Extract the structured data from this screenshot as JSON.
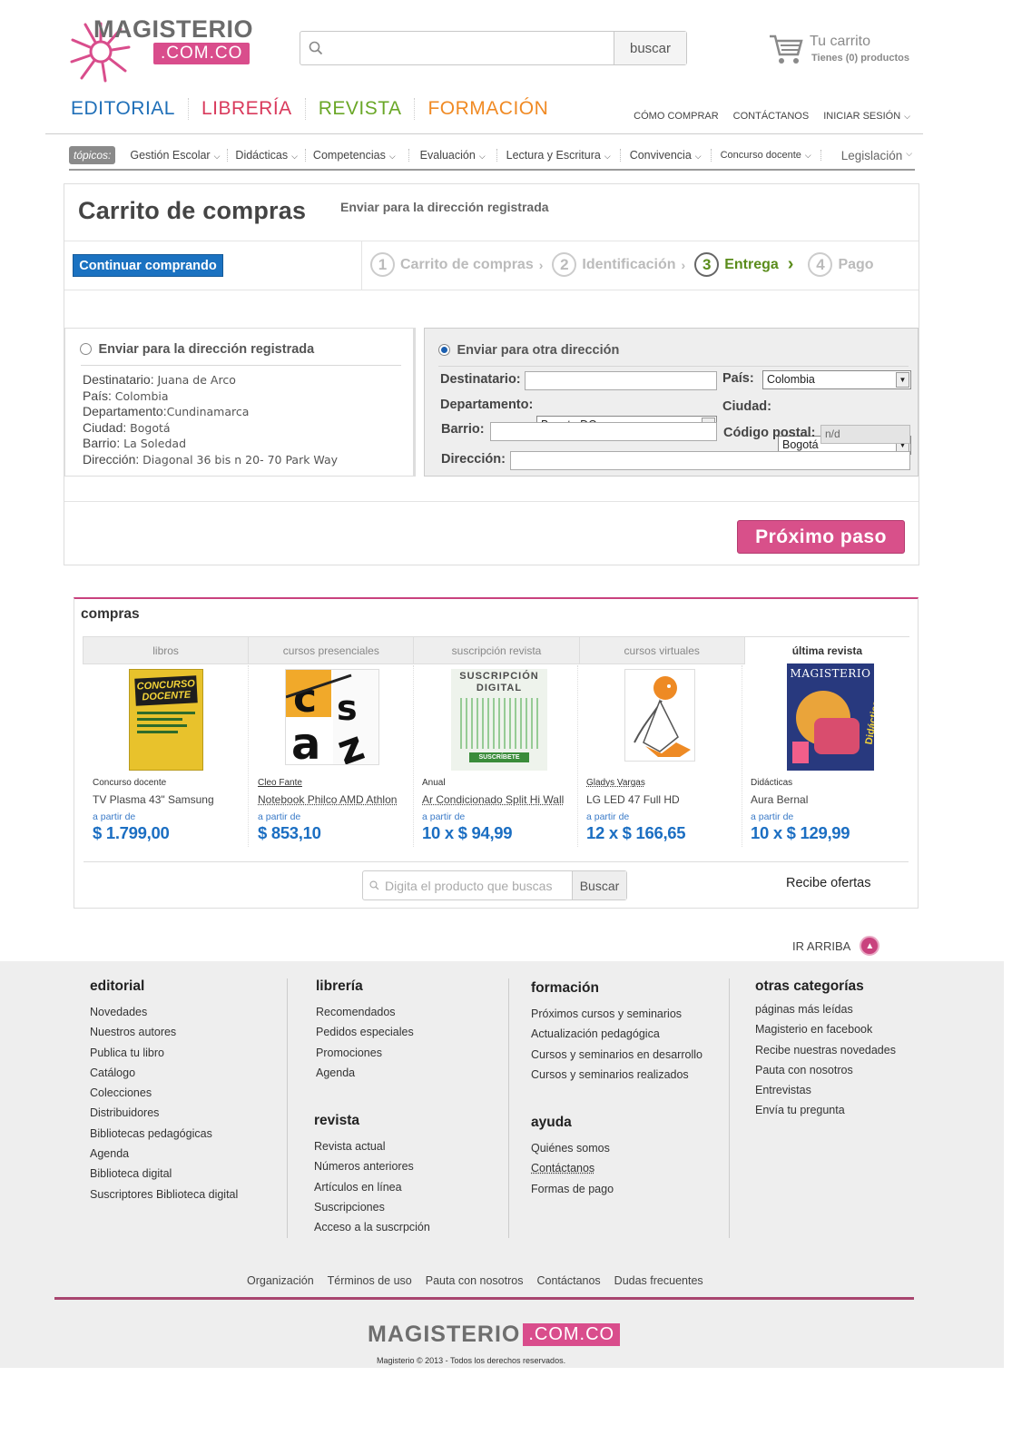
{
  "header": {
    "logo_word": "MAGISTERIO",
    "logo_com": ".COM.CO",
    "search_placeholder": "",
    "search_button": "buscar",
    "cart_title": "Tu carrito",
    "cart_count": "Tienes (0) productos"
  },
  "main_nav": [
    {
      "label": "EDITORIAL",
      "color": "#1f6fb8"
    },
    {
      "label": "LIBRERÍA",
      "color": "#d93a5c"
    },
    {
      "label": "REVISTA",
      "color": "#6aa727"
    },
    {
      "label": "FORMACIÓN",
      "color": "#f08a24"
    }
  ],
  "top_links": [
    "CÓMO COMPRAR",
    "CONTÁCTANOS",
    "INICIAR SESIÓN"
  ],
  "topics": {
    "tag": "tópicos:",
    "items": [
      "Gestión Escolar",
      "Didácticas",
      "Competencias",
      "Evaluación",
      "Lectura y Escritura",
      "Convivencia",
      "Concurso docente",
      "Legislación"
    ]
  },
  "checkout": {
    "title": "Carrito de compras",
    "subtitle": "Enviar para la dirección registrada",
    "continue_button": "Continuar comprando",
    "steps": [
      {
        "num": "1",
        "label": "Carrito de compras"
      },
      {
        "num": "2",
        "label": "Identificación"
      },
      {
        "num": "3",
        "label": "Entrega"
      },
      {
        "num": "4",
        "label": "Pago"
      }
    ],
    "registered": {
      "title": "Enviar para la dirección registrada",
      "rows": [
        {
          "label": "Destinatario:",
          "value": "Juana de Arco"
        },
        {
          "label": "País:",
          "value": "Colombia"
        },
        {
          "label": "Departamento:",
          "value": "Cundinamarca"
        },
        {
          "label": "Ciudad:",
          "value": "Bogotá"
        },
        {
          "label": "Barrio:",
          "value": "La Soledad"
        },
        {
          "label": "Dirección:",
          "value": "Diagonal 36 bis n 20- 70 Park Way"
        }
      ]
    },
    "other": {
      "title": "Enviar para otra dirección",
      "destinatario_label": "Destinatario:",
      "pais_label": "País:",
      "pais_value": "Colombia",
      "departamento_label": "Departamento:",
      "departamento_value": "Bogota DC",
      "ciudad_label": "Ciudad:",
      "ciudad_value": "Bogotá",
      "barrio_label": "Barrio:",
      "postal_label": "Código postal:",
      "postal_value": "n/d",
      "direccion_label": "Dirección:"
    },
    "next_button": "Próximo paso"
  },
  "compras": {
    "title": "compras",
    "tabs": [
      "libros",
      "cursos presenciales",
      "suscripción revista",
      "cursos virtuales",
      "última revista"
    ],
    "products": [
      {
        "cat": "Concurso docente",
        "name": "TV Plasma 43\" Samsung",
        "from": "a partir de",
        "price": "$ 1.799,00"
      },
      {
        "cat": "Cleo Fante",
        "name": "Notebook Philco AMD Athlon",
        "from": "a partir de",
        "price": "$ 853,10"
      },
      {
        "cat": "Anual",
        "name": "Ar Condicionado Split Hi Wall",
        "from": "a partir de",
        "price": "10 x $ 94,99"
      },
      {
        "cat": "Gladys Vargas",
        "name": "LG LED 47 Full HD",
        "from": "a partir de",
        "price": "12 x $ 166,65"
      },
      {
        "cat": "Didácticas",
        "name": "Aura Bernal",
        "from": "a partir de",
        "price": "10 x $ 129,99"
      }
    ],
    "product_images": {
      "book_title": "CONCURSO DOCENTE",
      "subs_title": "SUSCRIPCIÓN DIGITAL",
      "subs_button": "SUSCRÍBETE",
      "mag_title": "MAGISTERIO",
      "mag_sub": "Didácticas"
    },
    "search_placeholder": "Digita el producto que buscas",
    "search_button": "Buscar",
    "offers": "Recibe ofertas"
  },
  "back_top": "IR ARRIBA",
  "footer": {
    "columns": [
      {
        "title": "editorial",
        "items": [
          "Novedades",
          "Nuestros autores",
          "Publica tu libro",
          "Catálogo",
          "Colecciones",
          "Distribuidores",
          "Bibliotecas pedagógicas",
          "Agenda",
          "Biblioteca digital",
          "Suscriptores Biblioteca digital"
        ]
      },
      {
        "title": "librería",
        "items": [
          "Recomendados",
          "Pedidos especiales",
          "Promociones",
          "Agenda"
        ]
      },
      {
        "title": "revista",
        "items": [
          "Revista actual",
          "Números anteriores",
          "Artículos en línea",
          "Suscripciones",
          "Acceso a la suscrpción"
        ]
      },
      {
        "title": "formación",
        "items": [
          "Próximos cursos y seminarios",
          "Actualización pedagógica",
          "Cursos y seminarios en desarrollo",
          "Cursos y seminarios realizados"
        ]
      },
      {
        "title": "ayuda",
        "items": [
          "Quiénes somos",
          "Contáctanos",
          "Formas de pago"
        ]
      },
      {
        "title": "otras categorías",
        "items": [
          "páginas más leídas",
          "Magisterio en facebook",
          "Recibe nuestras novedades",
          "Pauta con nosotros",
          "Entrevistas",
          "Envía tu pregunta"
        ]
      }
    ],
    "links": [
      "Organización",
      "Términos de uso",
      "Pauta con nosotros",
      "Contáctanos",
      "Dudas frecuentes"
    ],
    "logo_word": "MAGISTERIO",
    "logo_com": ".COM.CO",
    "copyright": "Magisterio © 2013 - Todos los derechos reservados."
  }
}
